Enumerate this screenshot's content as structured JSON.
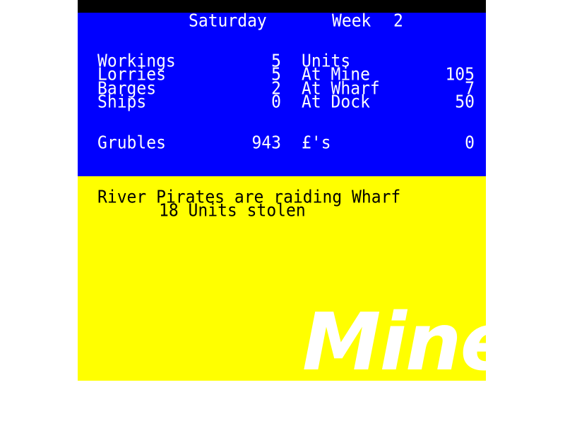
{
  "header": {
    "day": "Saturday",
    "week_label": "Week",
    "week_number": "2"
  },
  "left_stats": [
    {
      "label": "Workings",
      "value": "5"
    },
    {
      "label": "Lorries",
      "value": "5"
    },
    {
      "label": "Barges",
      "value": "2"
    },
    {
      "label": "Ships",
      "value": "0"
    }
  ],
  "right_stats": {
    "heading": "Units",
    "rows": [
      {
        "label": "At Mine",
        "value": "105"
      },
      {
        "label": "At Wharf",
        "value": "7"
      },
      {
        "label": "At Dock",
        "value": "50"
      }
    ]
  },
  "money": {
    "grubles_label": "Grubles",
    "grubles_value": "943",
    "pounds_label": "£'s",
    "pounds_value": "0"
  },
  "message": {
    "line1": "River Pirates are raiding Wharf",
    "line2": "18 Units stolen"
  },
  "logo_text": "Mine",
  "colors": {
    "stats_background": "#0000ff",
    "message_background": "#ffff00",
    "border": "#000000",
    "stats_text": "#ffffff",
    "message_text": "#000000",
    "logo": "#ffffff"
  }
}
